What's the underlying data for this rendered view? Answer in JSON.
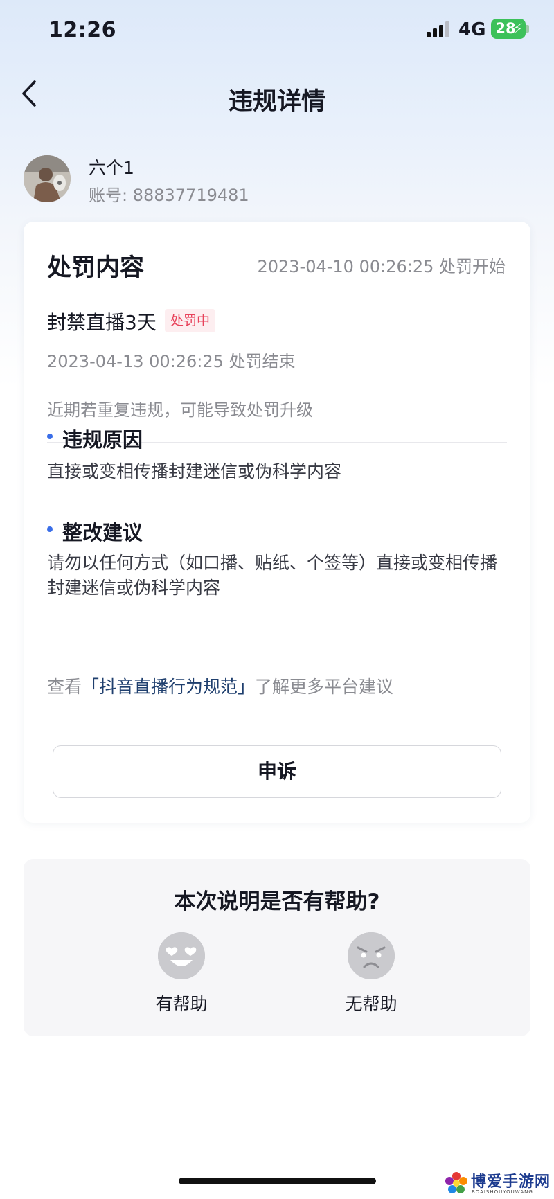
{
  "status_bar": {
    "time": "12:26",
    "network": "4G",
    "battery": "28"
  },
  "nav": {
    "title": "违规详情",
    "back_icon": "chevron-left-icon"
  },
  "user": {
    "name": "六个1",
    "account": "账号: 88837719481"
  },
  "penalty": {
    "section_title": "处罚内容",
    "start_time": "2023-04-10 00:26:25 处罚开始",
    "ban": "封禁直播3天",
    "status": "处罚中",
    "end_time": "2023-04-13 00:26:25 处罚结束",
    "warning": "近期若重复违规，可能导致处罚升级",
    "reason_title": "违规原因",
    "reason": "直接或变相传播封建迷信或伪科学内容",
    "suggestion_title": "整改建议",
    "suggestion_line1": "请勿以任何方式（如口播、贴纸、个签等）直接或变相传播",
    "suggestion_line2": "封建迷信或伪科学内容",
    "link_prefix": "查看",
    "link_text": "「抖音直播行为规范」",
    "link_suffix": "了解更多平台建议",
    "appeal_label": "申诉",
    "accent_color": "#3a6ee8",
    "status_color": "#e8425b"
  },
  "feedback": {
    "question": "本次说明是否有帮助?",
    "helpful_label": "有帮助",
    "helpful_icon": "heart-eyes-emoji-icon",
    "unhelpful_label": "无帮助",
    "unhelpful_icon": "angry-emoji-icon"
  },
  "watermark": {
    "text": "博爱手游网",
    "sub": "BOAISHOUYOUWANG"
  }
}
